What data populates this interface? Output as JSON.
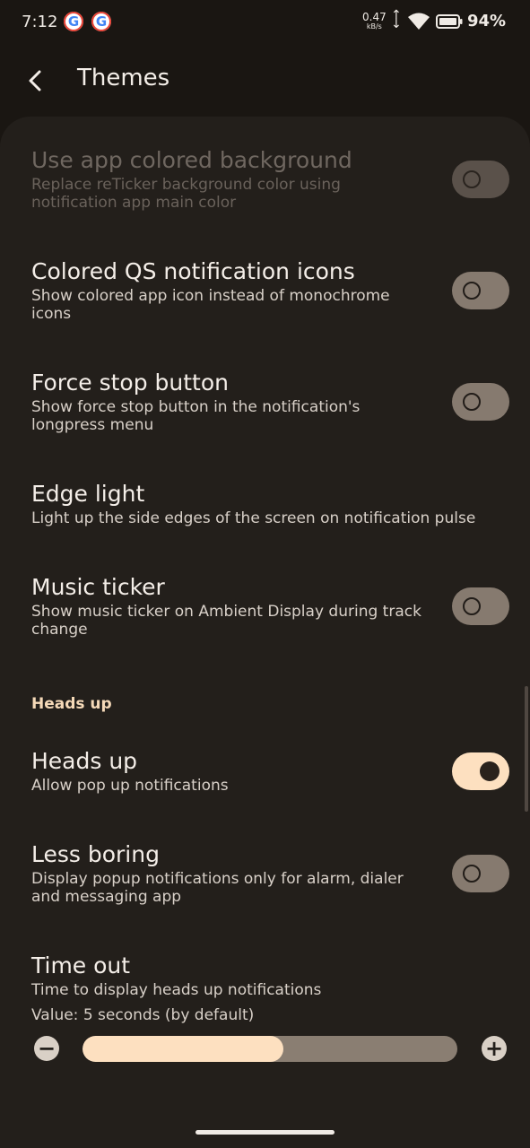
{
  "status_bar": {
    "time": "7:12",
    "google_badge": "G",
    "net_speed_value": "0.47",
    "net_speed_unit": "kB/s",
    "battery_percent": "94%"
  },
  "app_bar": {
    "title": "Themes"
  },
  "settings": {
    "use_app_colored_background": {
      "title": "Use app colored background",
      "summary": "Replace reTicker background color using notification app main color",
      "enabled": false,
      "checked": false
    },
    "colored_qs_icons": {
      "title": "Colored QS notification icons",
      "summary": "Show colored app icon instead of monochrome icons",
      "checked": false
    },
    "force_stop_button": {
      "title": "Force stop button",
      "summary": "Show force stop button in the notification's longpress menu",
      "checked": false
    },
    "edge_light": {
      "title": "Edge light",
      "summary": "Light up the side edges of the screen on notification pulse"
    },
    "music_ticker": {
      "title": "Music ticker",
      "summary": "Show music ticker on Ambient Display during track change",
      "checked": false
    },
    "heads_up_section": {
      "label": "Heads up"
    },
    "heads_up": {
      "title": "Heads up",
      "summary": "Allow pop up notifications",
      "checked": true
    },
    "less_boring": {
      "title": "Less boring",
      "summary": "Display popup notifications only for alarm, dialer and messaging app",
      "checked": false
    },
    "time_out": {
      "title": "Time out",
      "summary": "Time to display heads up notifications",
      "value_text": "Value: 5 seconds (by default)",
      "slider_fraction": 0.535,
      "minus_label": "−",
      "plus_label": "+"
    }
  },
  "colors": {
    "background": "#1a1612",
    "panel": "#231f1b",
    "accent": "#fde0c0",
    "toggle_off": "#867a6f"
  }
}
